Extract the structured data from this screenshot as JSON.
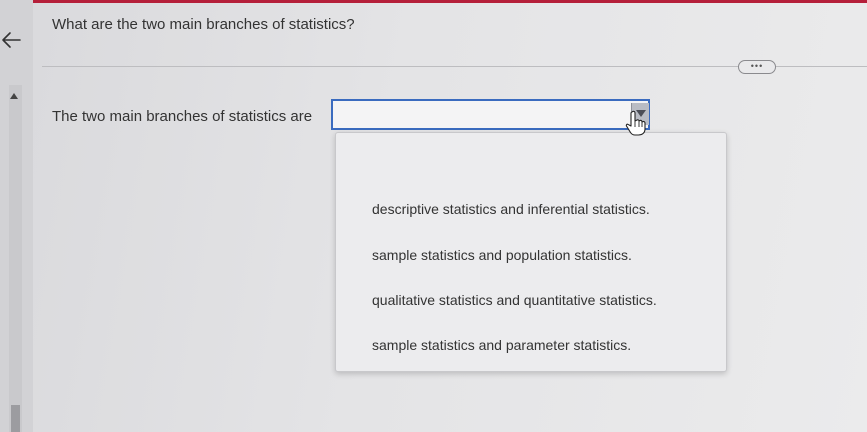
{
  "question": {
    "text": "What are the two main branches of statistics?"
  },
  "prompt": {
    "text": "The two main branches of statistics are"
  },
  "more_button": {
    "label": "•••"
  },
  "select": {
    "value": "",
    "state": "open"
  },
  "dropdown": {
    "options": [
      "descriptive statistics and inferential statistics.",
      "sample statistics and population statistics.",
      "qualitative statistics and quantitative statistics.",
      "sample statistics and parameter statistics."
    ]
  },
  "colors": {
    "top_strip": "#b51f3a",
    "select_border": "#3a6bbf"
  },
  "icons": [
    "back-arrow-icon",
    "scroll-up-icon",
    "chevron-down-icon",
    "hand-cursor-icon"
  ]
}
